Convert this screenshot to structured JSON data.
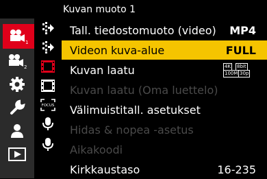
{
  "menu_title": "Kuvan muoto 1",
  "categories": [
    {
      "icon": "video-camera-icon",
      "sub": "1",
      "active": true
    },
    {
      "icon": "video-camera-icon",
      "sub": "2",
      "active": false
    },
    {
      "icon": "gear-icon",
      "active": false
    },
    {
      "icon": "wrench-icon",
      "active": false
    },
    {
      "icon": "person-icon",
      "active": false
    },
    {
      "icon": "playback-icon",
      "active": false
    }
  ],
  "sub_tabs": [
    {
      "icon": "star-focus-icon"
    },
    {
      "icon": "star-focus-icon"
    },
    {
      "icon": "film-strip-icon",
      "color": "#e0001a"
    },
    {
      "icon": "film-strip-icon"
    },
    {
      "icon": "focus-frame-icon",
      "text": "FOCUS"
    },
    {
      "icon": "microphone-icon"
    },
    {
      "icon": "microphone-icon"
    }
  ],
  "items": [
    {
      "label": "Tall. tiedostomuoto (video)",
      "value": "MP4"
    },
    {
      "label": "Videon kuva-alue",
      "value": "FULL",
      "selected": true
    },
    {
      "label": "Kuvan laatu",
      "badge": {
        "top_left": "4K",
        "top_right": "8bit",
        "bottom_left": "100M",
        "bottom_right": "30p"
      }
    },
    {
      "label": "Kuvan laatu (Oma luettelo)",
      "disabled": true
    },
    {
      "label": "Välimuistitall. asetukset"
    },
    {
      "label": "Hidas & nopea -asetus",
      "disabled": true
    },
    {
      "label": "Aikakoodi",
      "disabled": true
    },
    {
      "label": "Kirkkaustaso",
      "value": "16-235"
    }
  ],
  "colors": {
    "accent_red": "#e0001a",
    "highlight_yellow": "#f5c400",
    "disabled_text": "#4a4a4a"
  }
}
